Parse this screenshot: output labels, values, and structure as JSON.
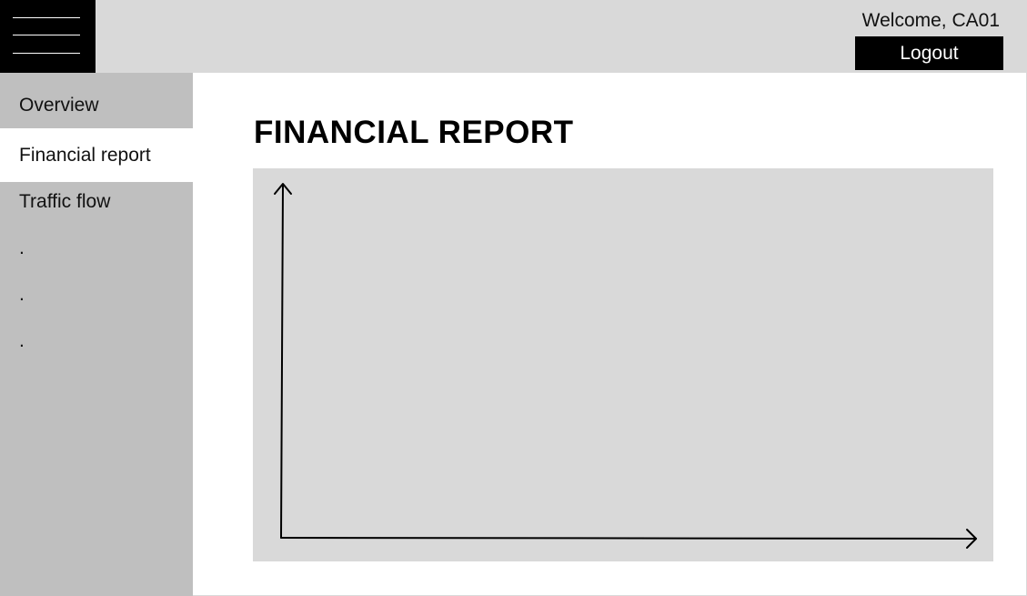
{
  "header": {
    "welcome_text": "Welcome, CA01",
    "logout_label": "Logout",
    "menu_icon": "hamburger-menu-icon"
  },
  "sidebar": {
    "items": [
      {
        "label": "Overview",
        "active": false
      },
      {
        "label": "Financial report",
        "active": true
      },
      {
        "label": "Traffic flow",
        "active": false
      }
    ],
    "placeholders": [
      ".",
      ".",
      "."
    ]
  },
  "main": {
    "title": "FINANCIAL REPORT"
  },
  "colors": {
    "topbar_bg": "#d9d9d9",
    "sidebar_bg": "#bfbfbf",
    "active_item_bg": "#ffffff",
    "button_bg": "#000000",
    "chart_bg": "#d9d9d9"
  }
}
